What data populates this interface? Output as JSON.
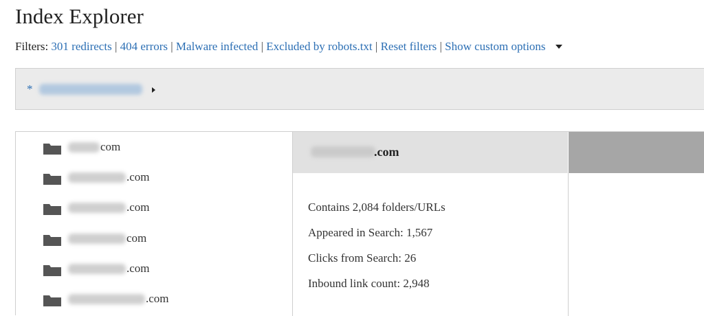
{
  "page": {
    "title": "Index Explorer"
  },
  "filters": {
    "label": "Filters:",
    "links": [
      {
        "label": "301 redirects"
      },
      {
        "label": "404 errors"
      },
      {
        "label": "Malware infected"
      },
      {
        "label": "Excluded by robots.txt"
      },
      {
        "label": "Reset filters"
      },
      {
        "label": "Show custom options"
      }
    ],
    "separator": "|"
  },
  "breadcrumb": {
    "prefix": "*"
  },
  "tree": {
    "items": [
      {
        "suffix": "com"
      },
      {
        "suffix": ".com"
      },
      {
        "suffix": ".com"
      },
      {
        "suffix": "com"
      },
      {
        "suffix": ".com"
      },
      {
        "suffix": ".com"
      }
    ]
  },
  "detail": {
    "title_suffix": ".com",
    "stats": {
      "contains": "Contains 2,084 folders/URLs",
      "appeared": "Appeared in Search: 1,567",
      "clicks": "Clicks from Search: 26",
      "inbound": "Inbound link count: 2,948"
    }
  },
  "colors": {
    "link": "#2c6fb4",
    "header_bg": "#e1e1e1",
    "right_bar": "#a6a6a6",
    "breadcrumb_bg": "#ebebeb"
  },
  "icons": {
    "folder": "folder-icon",
    "dropdown": "caret-down-icon",
    "expand": "caret-right-icon"
  }
}
